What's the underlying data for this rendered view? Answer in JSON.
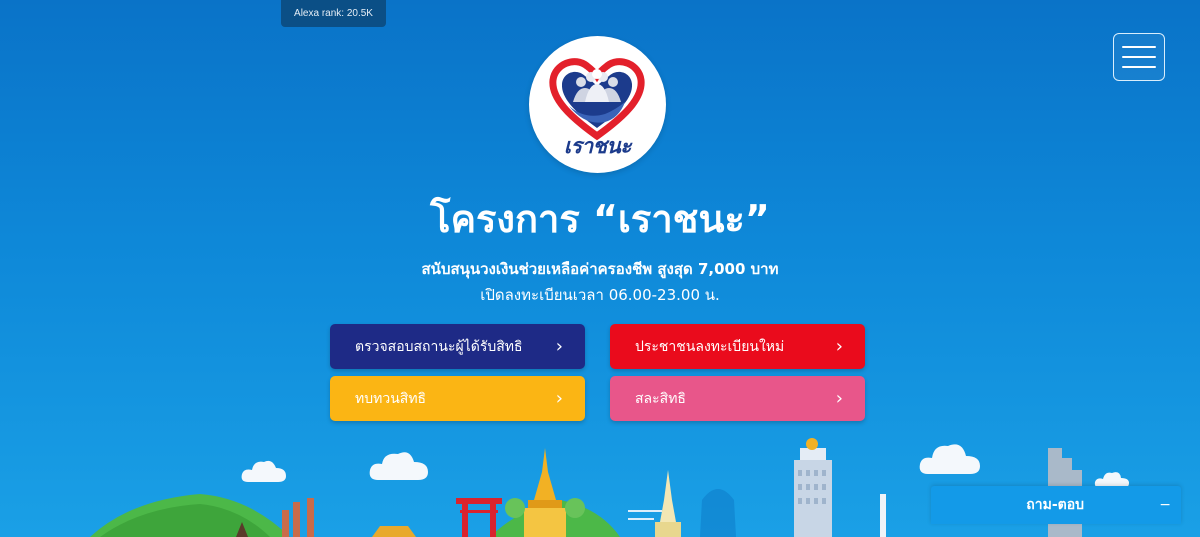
{
  "alexa": {
    "text": "Alexa rank: 20.5K"
  },
  "logo": {
    "text": "เราชนะ"
  },
  "hero": {
    "title": "โครงการ “เราชนะ”",
    "subtitle": "สนับสนุนวงเงินช่วยเหลือค่าครองชีพ สูงสุด 7,000 บาท",
    "hours": "เปิดลงทะเบียนเวลา 06.00-23.00 น."
  },
  "buttons": {
    "check_status": "ตรวจสอบสถานะผู้ได้รับสิทธิ",
    "new_register": "ประชาชนลงทะเบียนใหม่",
    "review_rights": "ทบทวนสิทธิ",
    "waive_rights": "สละสิทธิ",
    "chevron": "›"
  },
  "qa": {
    "label": "ถาม-ตอบ",
    "minimize": "−"
  },
  "colors": {
    "background": "#0e88d8",
    "check_status": "#1e2a86",
    "new_register": "#ea0b1c",
    "review_rights": "#fbb514",
    "waive_rights": "#e8568a",
    "qa_bar": "#139ae8"
  },
  "icons": [
    "hamburger-menu-icon",
    "chevron-right-icon",
    "heart-hands-logo"
  ]
}
